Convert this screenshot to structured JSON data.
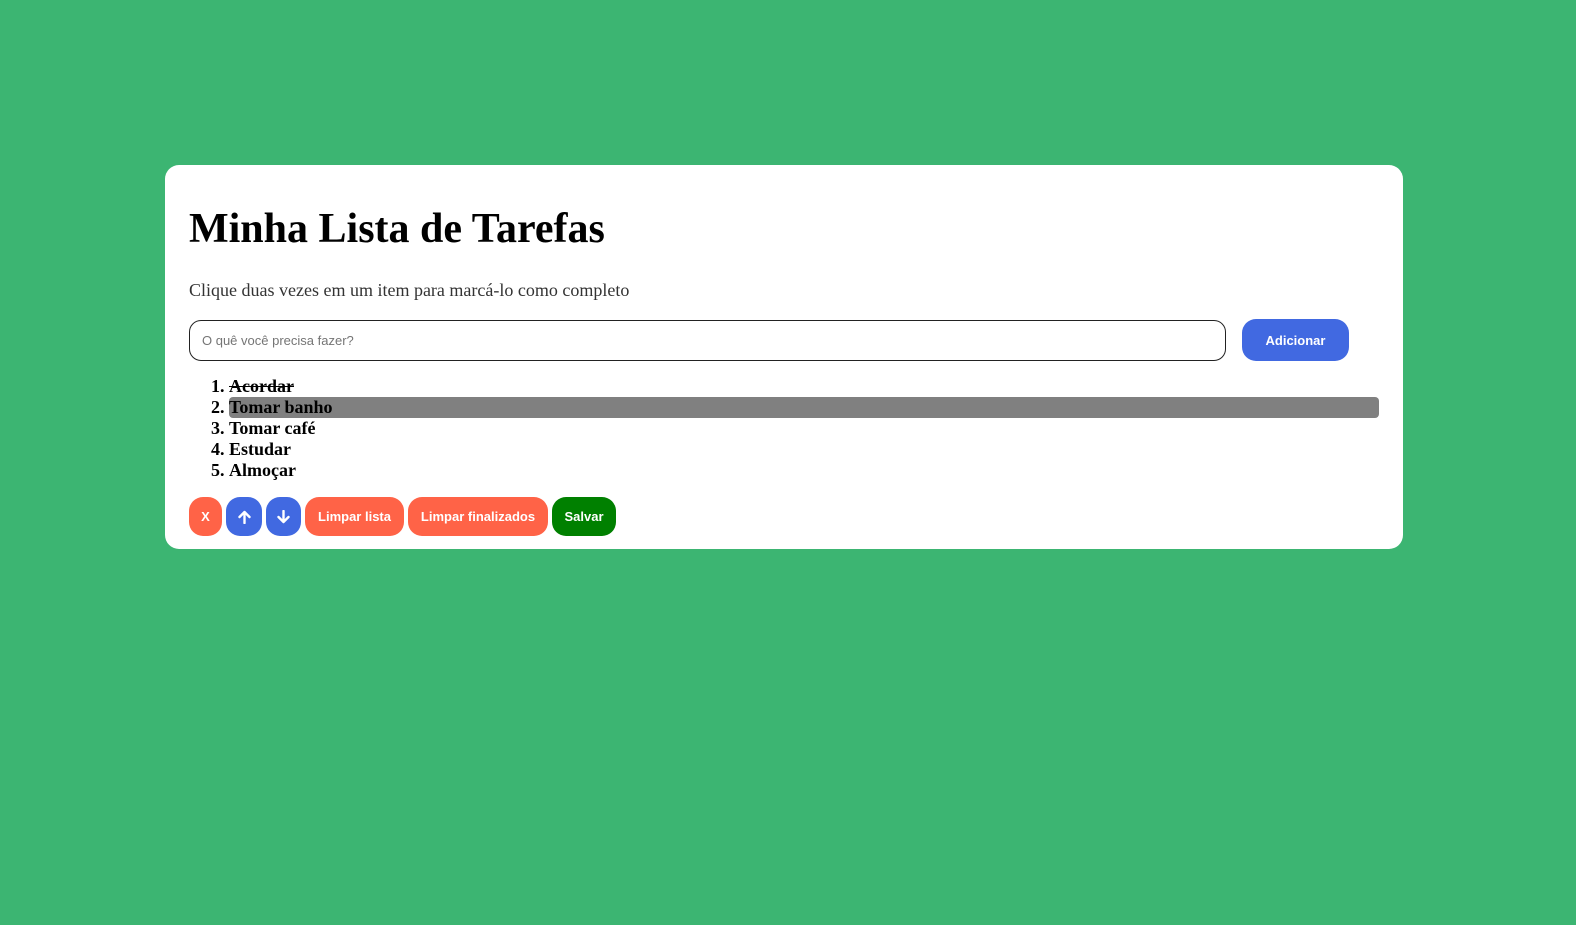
{
  "page": {
    "title": "Minha Lista de Tarefas",
    "subtitle": "Clique duas vezes em um item para marcá-lo como completo"
  },
  "form": {
    "input_value": "",
    "input_placeholder": "O quê você precisa fazer?",
    "add_label": "Adicionar"
  },
  "tasks": [
    {
      "label": "Acordar",
      "completed": true,
      "selected": false
    },
    {
      "label": "Tomar banho",
      "completed": false,
      "selected": true
    },
    {
      "label": "Tomar café",
      "completed": false,
      "selected": false
    },
    {
      "label": "Estudar",
      "completed": false,
      "selected": false
    },
    {
      "label": "Almoçar",
      "completed": false,
      "selected": false
    }
  ],
  "actions": {
    "remove_label": "X",
    "move_up_icon": "arrow-up-icon",
    "move_down_icon": "arrow-down-icon",
    "clear_list_label": "Limpar lista",
    "clear_done_label": "Limpar finalizados",
    "save_label": "Salvar"
  },
  "colors": {
    "background": "#3cb572",
    "card": "#ffffff",
    "primary": "#4169e1",
    "danger": "#ff6347",
    "success": "#008000",
    "selected_item": "#808080"
  }
}
